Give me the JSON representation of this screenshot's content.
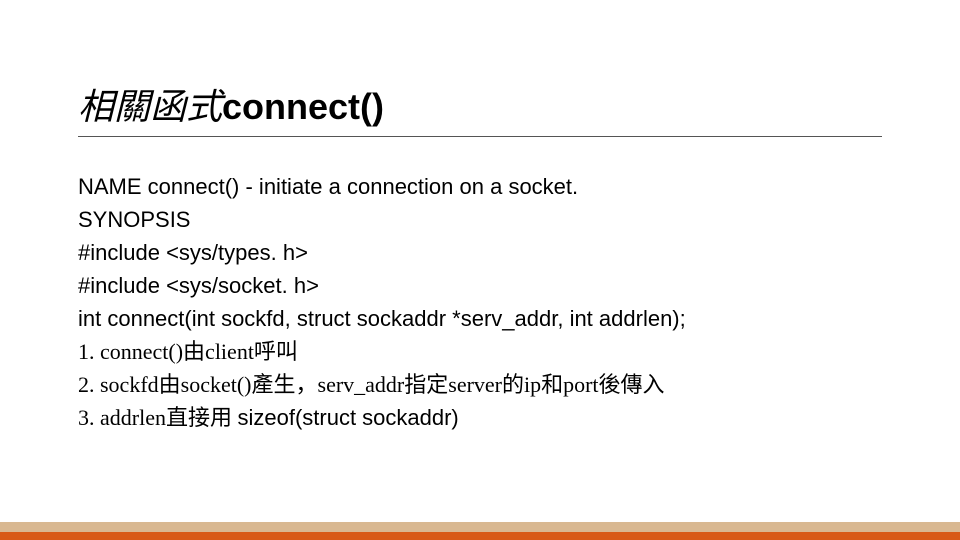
{
  "title": {
    "cjk": "相關函式",
    "latin": "connect()"
  },
  "body": {
    "l1": "NAME connect() - initiate a connection on a socket.",
    "l2": "SYNOPSIS",
    "l3": "#include <sys/types. h>",
    "l4": "#include <sys/socket. h>",
    "l5": "int connect(int sockfd, struct sockaddr *serv_addr, int addrlen);",
    "l6_a": "1.  connect()由client呼叫",
    "l7_a": "2.  sockfd由socket()產生，serv_addr指定server的ip和port後傳入",
    "l8_a": "3.  addrlen直接用 ",
    "l8_b": "sizeof(struct sockaddr)"
  }
}
